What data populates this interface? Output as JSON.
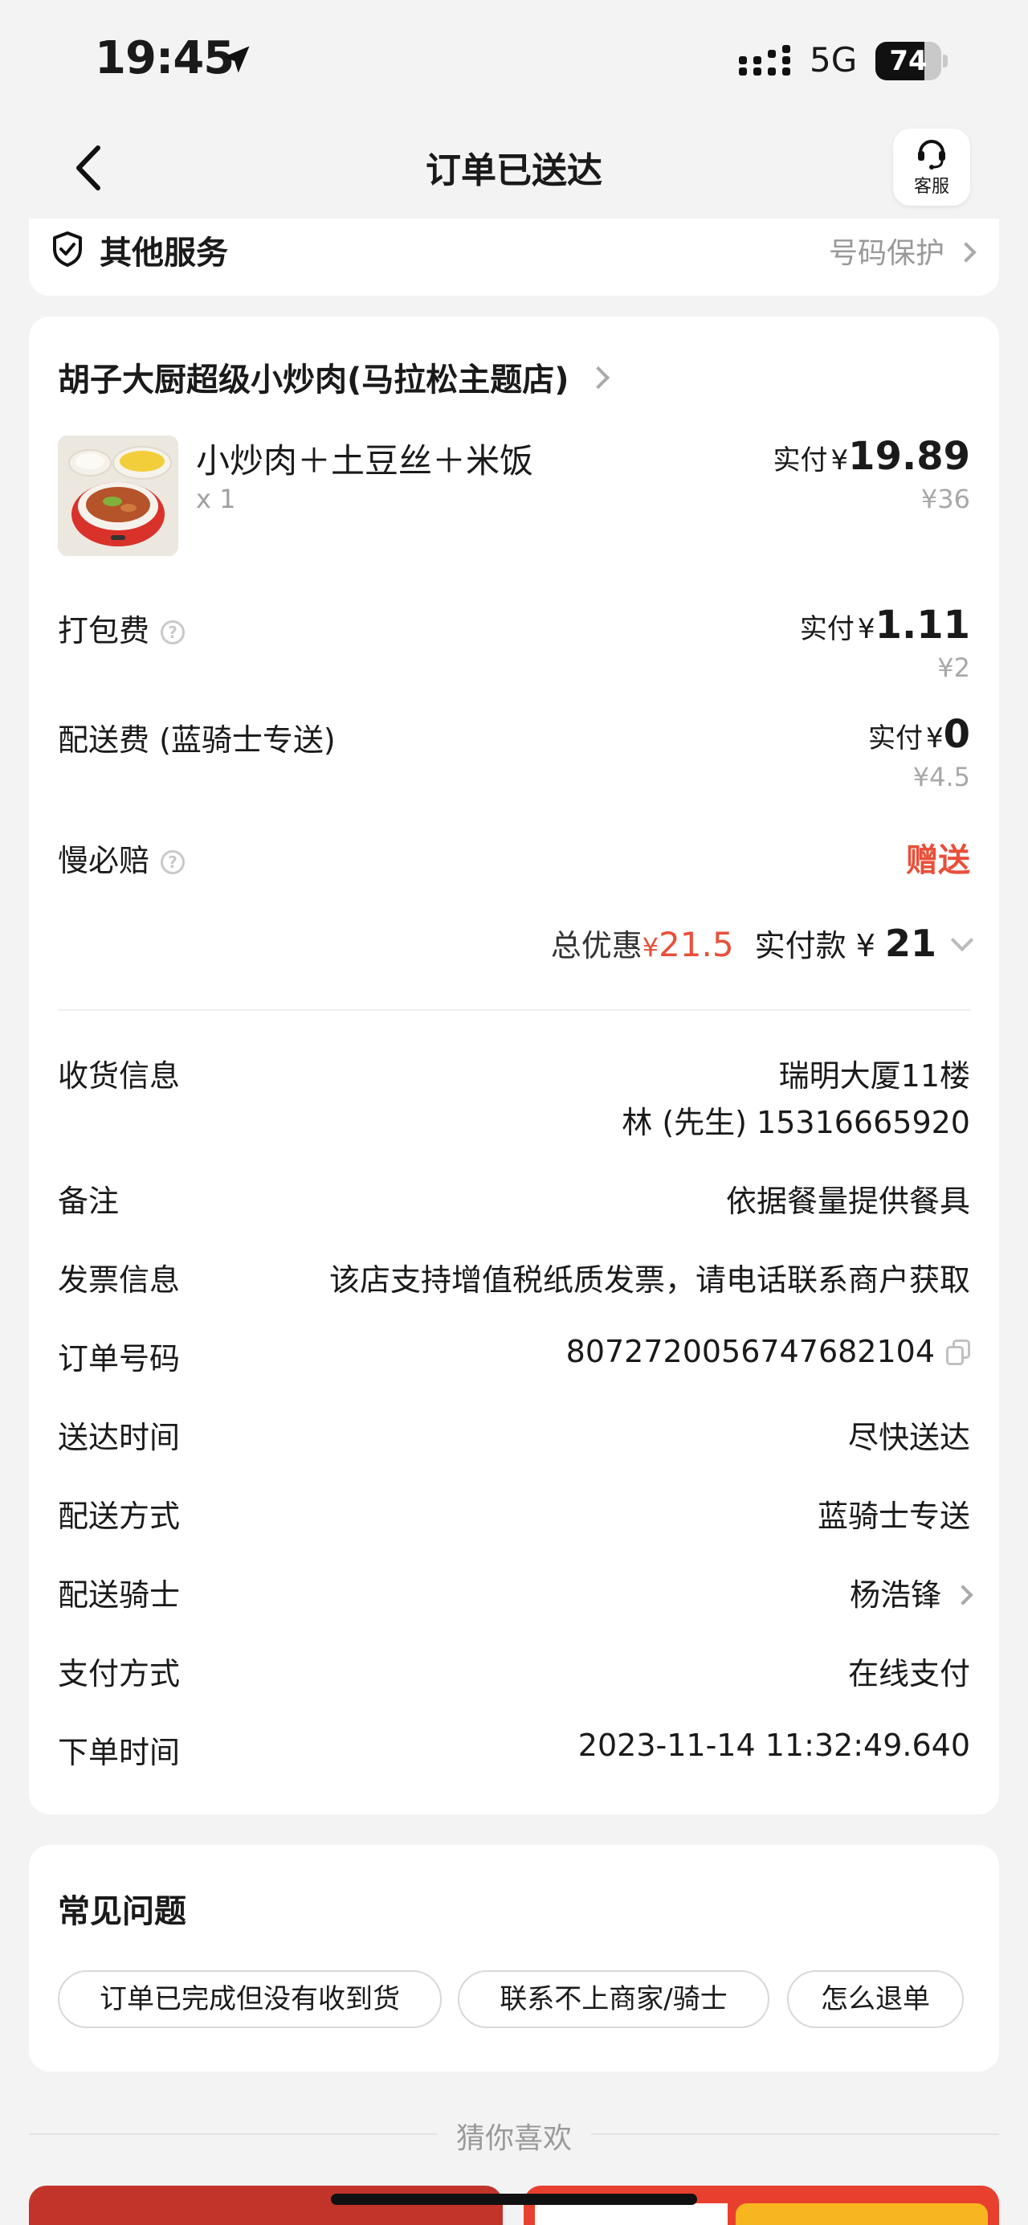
{
  "status_bar": {
    "time": "19:45",
    "network": "5G",
    "battery": "74",
    "battery_level": 0.74
  },
  "nav": {
    "title": "订单已送达",
    "service_label": "客服"
  },
  "other_services": {
    "title": "其他服务",
    "right_text": "号码保护"
  },
  "order": {
    "shop_name": "胡子大厨超级小炒肉(马拉松主题店)",
    "dish": {
      "name": "小炒肉＋土豆丝＋米饭",
      "qty": "x 1",
      "paid_label": "实付",
      "paid_yen": "¥",
      "paid": "19.89",
      "original": "¥36"
    },
    "packing": {
      "label": "打包费",
      "paid_label": "实付",
      "paid_yen": "¥",
      "paid": "1.11",
      "original": "¥2"
    },
    "delivery": {
      "label": "配送费 (蓝骑士专送)",
      "paid_label": "实付",
      "paid_yen": "¥",
      "paid": "0",
      "original": "¥4.5"
    },
    "slow_comp": {
      "label": "慢必赔",
      "value": "赠送"
    },
    "summary": {
      "discount_label": "总优惠",
      "discount_yen": "¥",
      "discount": "21.5",
      "paid_label": "实付款",
      "paid_yen": "¥",
      "paid": "21"
    }
  },
  "info": {
    "receiver_label": "收货信息",
    "receiver_address": "瑞明大厦11楼",
    "receiver_contact": "林 (先生) 15316665920",
    "note_label": "备注",
    "note_value": "依据餐量提供餐具",
    "invoice_label": "发票信息",
    "invoice_value": "该店支持增值税纸质发票，请电话联系商户获取",
    "order_no_label": "订单号码",
    "order_no_value": "8072720056747682104",
    "arrive_label": "送达时间",
    "arrive_value": "尽快送达",
    "method_label": "配送方式",
    "method_value": "蓝骑士专送",
    "rider_label": "配送骑士",
    "rider_value": "杨浩锋",
    "pay_label": "支付方式",
    "pay_value": "在线支付",
    "order_time_label": "下单时间",
    "order_time_value": "2023-11-14 11:32:49.640"
  },
  "faq": {
    "title": "常见问题",
    "chips": [
      "订单已完成但没有收到货",
      "联系不上商家/骑士",
      "怎么退单"
    ]
  },
  "recommend": {
    "title": "猜你喜欢"
  },
  "colors": {
    "accent_red": "#e8503a",
    "background": "#f3f3f3",
    "card": "#ffffff"
  }
}
